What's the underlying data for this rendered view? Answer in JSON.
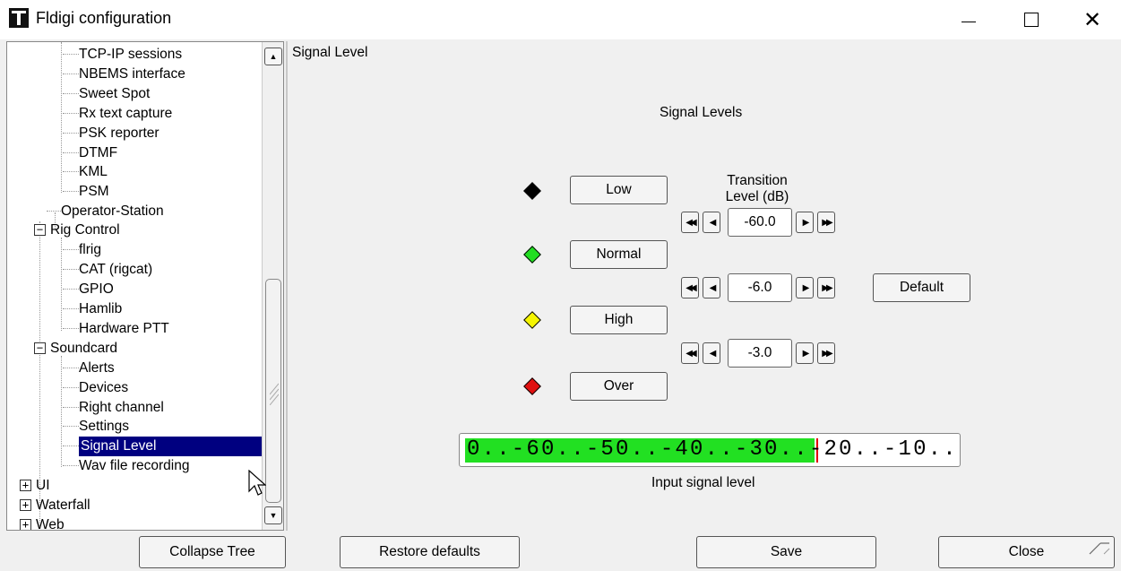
{
  "window": {
    "title": "Fldigi configuration",
    "controls": {
      "minimize": "minimize",
      "maximize": "maximize",
      "close": "✕"
    }
  },
  "tree": {
    "items": [
      {
        "label": "TCP-IP sessions"
      },
      {
        "label": "NBEMS interface"
      },
      {
        "label": "Sweet Spot"
      },
      {
        "label": "Rx text capture"
      },
      {
        "label": "PSK reporter"
      },
      {
        "label": "DTMF"
      },
      {
        "label": "KML"
      },
      {
        "label": "PSM"
      },
      {
        "label": "Operator-Station"
      },
      {
        "label": "Rig Control"
      },
      {
        "label": "flrig"
      },
      {
        "label": "CAT (rigcat)"
      },
      {
        "label": "GPIO"
      },
      {
        "label": "Hamlib"
      },
      {
        "label": "Hardware PTT"
      },
      {
        "label": "Soundcard"
      },
      {
        "label": "Alerts"
      },
      {
        "label": "Devices"
      },
      {
        "label": "Right channel"
      },
      {
        "label": "Settings"
      },
      {
        "label": "Signal Level"
      },
      {
        "label": "Wav file recording"
      },
      {
        "label": "UI"
      },
      {
        "label": "Waterfall"
      },
      {
        "label": "Web"
      }
    ],
    "selected": "Signal Level",
    "expander_minus": "−",
    "expander_plus": "+"
  },
  "panel": {
    "title": "Signal Level",
    "section_title": "Signal Levels",
    "transition_label": "Transition Level (dB)",
    "levels": [
      {
        "label": "Low",
        "color": "#000000"
      },
      {
        "label": "Normal",
        "color": "#22dd22"
      },
      {
        "label": "High",
        "color": "#f5f500"
      },
      {
        "label": "Over",
        "color": "#e01010"
      }
    ],
    "transitions": [
      "-60.0",
      "-6.0",
      "-3.0"
    ],
    "default_button": "Default",
    "meter": {
      "scale_text": "0..-60..-50..-40..-30..-20..-10...|",
      "fill_color": "#22e022",
      "marker_color": "#e00000",
      "caption": "Input signal level"
    }
  },
  "footer": {
    "collapse_tree": "Collapse Tree",
    "restore_defaults": "Restore defaults",
    "save": "Save",
    "close": "Close"
  }
}
